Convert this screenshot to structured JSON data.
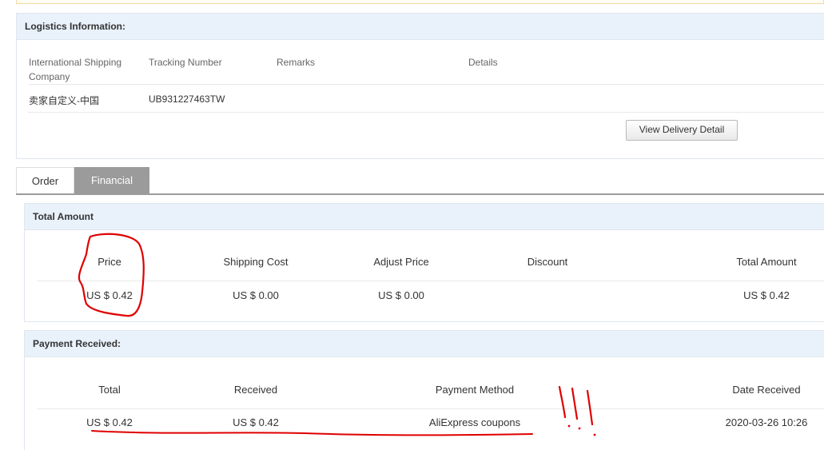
{
  "logistics": {
    "title": "Logistics Information:",
    "headers": {
      "company_line1": "International Shipping",
      "company_line2": "Company",
      "tracking": "Tracking Number",
      "remarks": "Remarks",
      "details": "Details"
    },
    "row": {
      "company": "卖家自定义-中国",
      "tracking": "UB931227463TW",
      "remarks": "",
      "details": ""
    },
    "view_delivery_label": "View Delivery Detail"
  },
  "tabs": [
    {
      "label": "Order",
      "active": false
    },
    {
      "label": "Financial",
      "active": true
    }
  ],
  "total_amount": {
    "title": "Total Amount",
    "headers": [
      "Price",
      "Shipping Cost",
      "Adjust Price",
      "Discount",
      "Total Amount"
    ],
    "values": [
      "US $ 0.42",
      "US $ 0.00",
      "US $ 0.00",
      "",
      "US $ 0.42"
    ]
  },
  "payment_received": {
    "title": "Payment Received:",
    "headers": [
      "Total",
      "Received",
      "Payment Method",
      "Date Received"
    ],
    "values": [
      "US $ 0.42",
      "US $ 0.42",
      "AliExpress coupons",
      "2020-03-26 10:26"
    ]
  },
  "colors": {
    "header_bg": "#e9f1fb",
    "border": "#dfe6ee",
    "tab_active_bg": "#9b9b9b",
    "annotation_red": "#e00000"
  }
}
